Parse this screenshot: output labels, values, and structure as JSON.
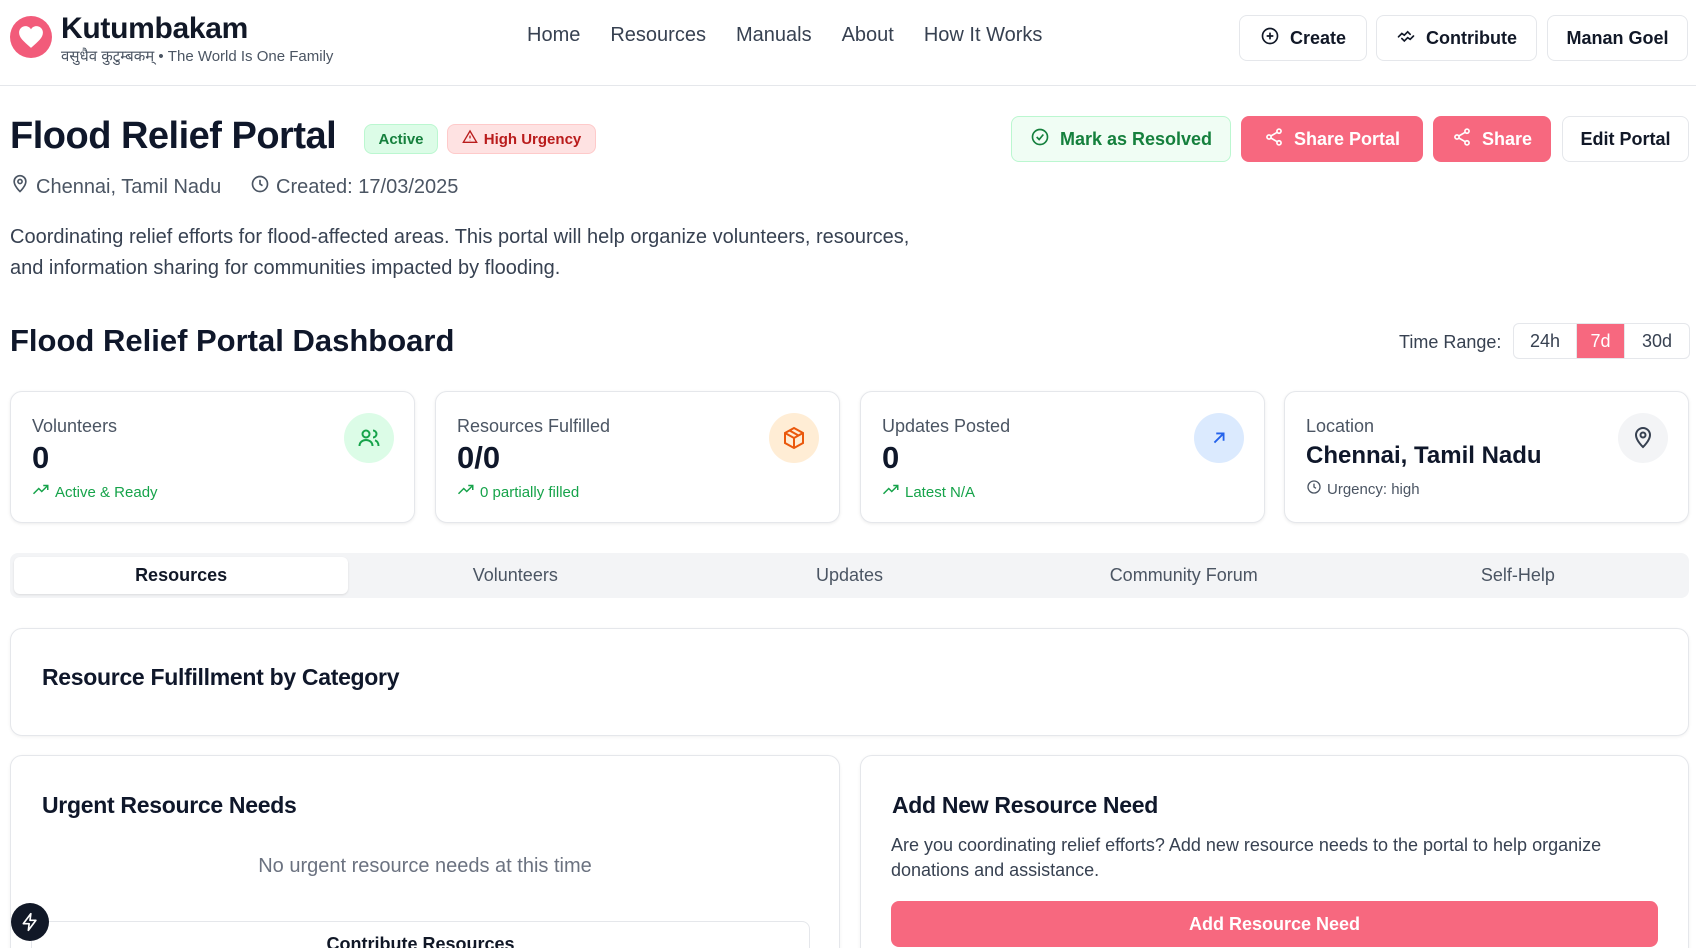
{
  "header": {
    "brand_name": "Kutumbakam",
    "brand_tagline": "वसुधैव कुटुम्बकम् • The World Is One Family",
    "nav": [
      "Home",
      "Resources",
      "Manuals",
      "About",
      "How It Works"
    ],
    "create_label": "Create",
    "contribute_label": "Contribute",
    "user_name": "Manan Goel"
  },
  "portal": {
    "title": "Flood Relief Portal",
    "status_badge": "Active",
    "urgency_badge": "High Urgency",
    "location": "Chennai, Tamil Nadu",
    "created": "Created: 17/03/2025",
    "description": "Coordinating relief efforts for flood-affected areas. This portal will help organize volunteers, resources, and information sharing for communities impacted by flooding.",
    "actions": {
      "resolve": "Mark as Resolved",
      "share_portal": "Share Portal",
      "share": "Share",
      "edit": "Edit Portal"
    }
  },
  "dashboard": {
    "title": "Flood Relief Portal Dashboard",
    "time_range_label": "Time Range:",
    "time_ranges": [
      "24h",
      "7d",
      "30d"
    ],
    "selected_range": "7d",
    "cards": {
      "volunteers": {
        "label": "Volunteers",
        "value": "0",
        "sub": "Active & Ready"
      },
      "resources": {
        "label": "Resources Fulfilled",
        "value": "0/0",
        "sub": "0 partially filled"
      },
      "updates": {
        "label": "Updates Posted",
        "value": "0",
        "sub": "Latest N/A"
      },
      "location": {
        "label": "Location",
        "value": "Chennai, Tamil Nadu",
        "sub": "Urgency: high"
      }
    }
  },
  "tabs": [
    "Resources",
    "Volunteers",
    "Updates",
    "Community Forum",
    "Self-Help"
  ],
  "active_tab": "Resources",
  "panels": {
    "fulfillment_title": "Resource Fulfillment by Category",
    "urgent_title": "Urgent Resource Needs",
    "urgent_empty": "No urgent resource needs at this time",
    "contribute_button": "Contribute Resources",
    "add_title": "Add New Resource Need",
    "add_description": "Are you coordinating relief efforts? Add new resource needs to the portal to help organize donations and assistance.",
    "add_button": "Add Resource Need"
  },
  "colors": {
    "accent": "#f7687f",
    "logo": "#f25b7a",
    "success": "#16a34a",
    "danger": "#b91c1c"
  }
}
